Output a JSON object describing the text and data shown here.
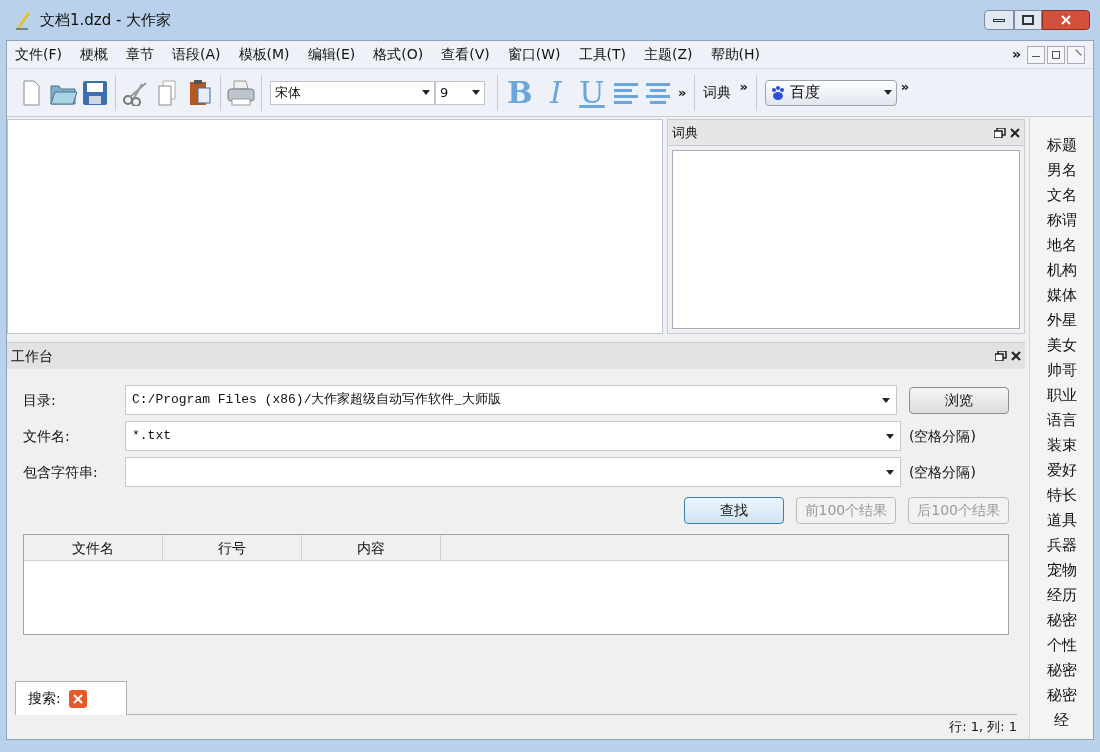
{
  "window": {
    "title": "文档1.dzd - 大作家"
  },
  "menu": [
    "文件(F)",
    "梗概",
    "章节",
    "语段(A)",
    "模板(M)",
    "编辑(E)",
    "格式(O)",
    "查看(V)",
    "窗口(W)",
    "工具(T)",
    "主题(Z)",
    "帮助(H)"
  ],
  "menu_overflow": "»",
  "toolbar": {
    "font": "宋体",
    "size": "9",
    "format_buttons": [
      {
        "label": "B",
        "kind": "bold"
      },
      {
        "label": "I",
        "kind": "italic"
      },
      {
        "label": "U",
        "kind": "underline"
      }
    ],
    "overflow": [
      "»",
      "»",
      "»"
    ],
    "dictionary_label": "词典",
    "search_engine": "百度"
  },
  "dictionary_panel": {
    "title": "词典"
  },
  "sidebar": {
    "items": [
      "标题",
      "男名",
      "文名",
      "称谓",
      "地名",
      "机构",
      "媒体",
      "外星",
      "美女",
      "帅哥",
      "职业",
      "语言",
      "装束",
      "爱好",
      "特长",
      "道具",
      "兵器",
      "宠物",
      "经历",
      "秘密",
      "个性",
      "秘密",
      "秘密",
      "经"
    ]
  },
  "workbench": {
    "title": "工作台",
    "fields": [
      {
        "label": "目录:",
        "value": "C:/Program Files (x86)/大作家超级自动写作软件_大师版",
        "kind": "browse",
        "action": "浏览"
      },
      {
        "label": "文件名:",
        "value": "*.txt",
        "kind": "hint",
        "action": "(空格分隔)"
      },
      {
        "label": "包含字符串:",
        "kind": "hint",
        "action": "(空格分隔)"
      }
    ],
    "buttons": [
      {
        "label": "查找",
        "disabled": false,
        "selected": true
      },
      {
        "label": "前100个结果",
        "disabled": true,
        "selected": false
      },
      {
        "label": "后100个结果",
        "disabled": true,
        "selected": false
      }
    ],
    "table": {
      "columns": [
        "文件名",
        "行号",
        "内容"
      ]
    },
    "tabs": [
      {
        "label": "搜索:",
        "selected": true
      }
    ]
  },
  "status_bar": "行: 1, 列: 1"
}
